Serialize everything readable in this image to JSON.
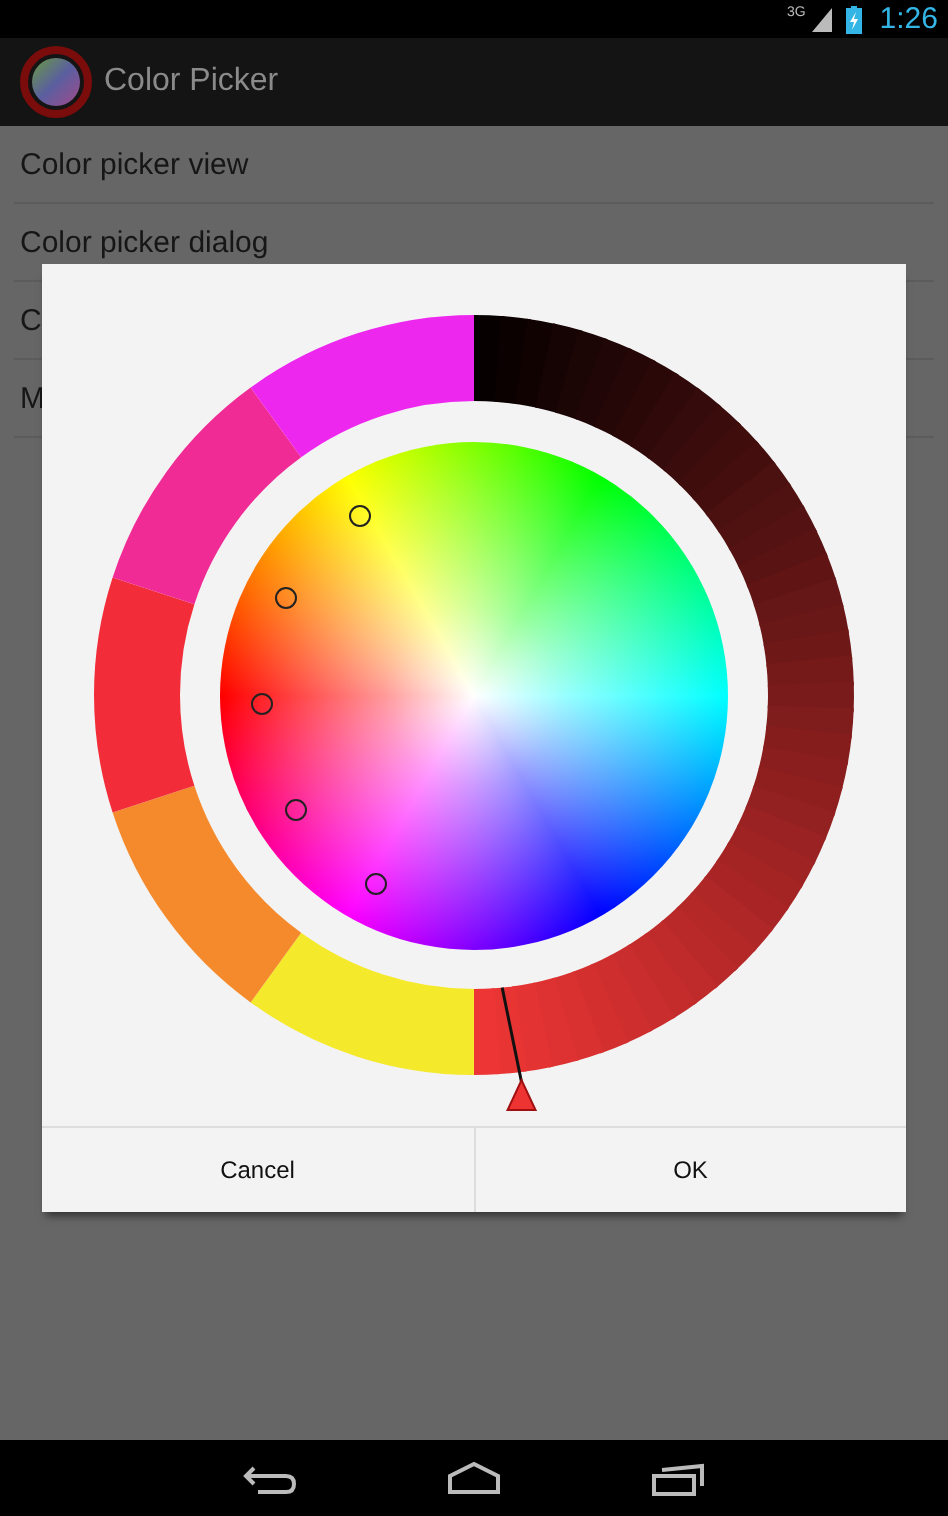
{
  "status_bar": {
    "network": "3G",
    "time": "1:26"
  },
  "action_bar": {
    "title": "Color Picker"
  },
  "list": [
    {
      "label": "Color picker view"
    },
    {
      "label": "Color picker dialog"
    },
    {
      "label": "C"
    },
    {
      "label": "M"
    }
  ],
  "dialog": {
    "palette": [
      {
        "color": "#f4e92a"
      },
      {
        "color": "#f58a2d"
      },
      {
        "color": "#f22d39"
      },
      {
        "color": "#f02b95"
      },
      {
        "color": "#ee27ef"
      }
    ],
    "buttons": [
      {
        "label": "Cancel"
      },
      {
        "label": "OK"
      }
    ]
  }
}
